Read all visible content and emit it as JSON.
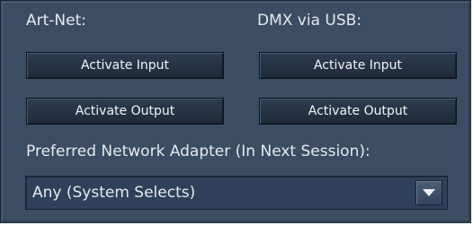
{
  "artnet": {
    "label": "Art-Net:",
    "activate_input": "Activate Input",
    "activate_output": "Activate Output"
  },
  "dmx_usb": {
    "label": "DMX via USB:",
    "activate_input": "Activate Input",
    "activate_output": "Activate Output"
  },
  "network": {
    "label": "Preferred Network Adapter (In Next Session):",
    "selected": "Any (System Selects)",
    "dropdown_icon": "chevron-down-icon"
  },
  "colors": {
    "panel_background": "#3b4c63",
    "button_background": "#263345",
    "text": "#e6e9ee"
  }
}
